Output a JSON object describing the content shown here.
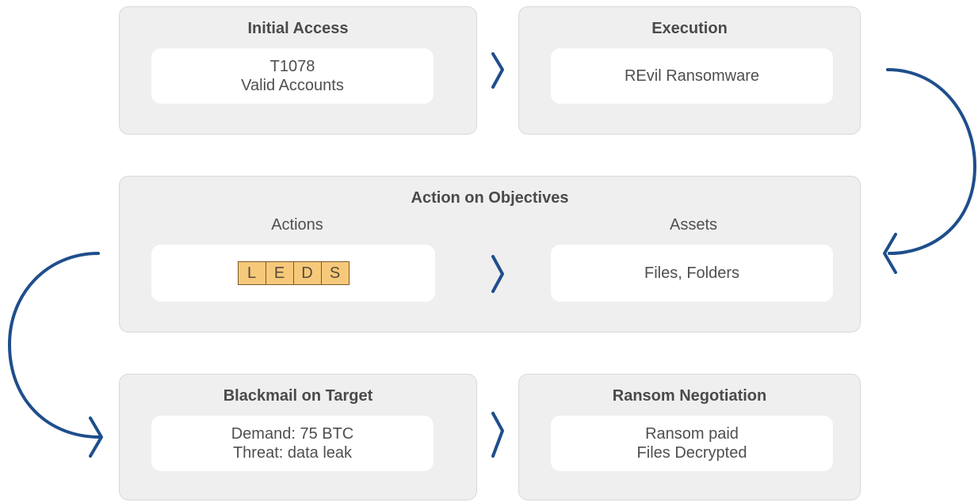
{
  "initial_access": {
    "title": "Initial Access",
    "line1": "T1078",
    "line2": "Valid Accounts"
  },
  "execution": {
    "title": "Execution",
    "text": "REvil Ransomware"
  },
  "action_on_objectives": {
    "title": "Action on Objectives",
    "actions_label": "Actions",
    "assets_label": "Assets",
    "leds": [
      "L",
      "E",
      "D",
      "S"
    ],
    "assets_text": "Files, Folders"
  },
  "blackmail": {
    "title": "Blackmail on Target",
    "line1": "Demand: 75 BTC",
    "line2": "Threat: data leak"
  },
  "negotiation": {
    "title": "Ransom Negotiation",
    "line1": "Ransom paid",
    "line2": "Files Decrypted"
  },
  "colors": {
    "arrow": "#1f4e8c",
    "led_fill": "#f6c97a",
    "panel": "#efefef"
  }
}
